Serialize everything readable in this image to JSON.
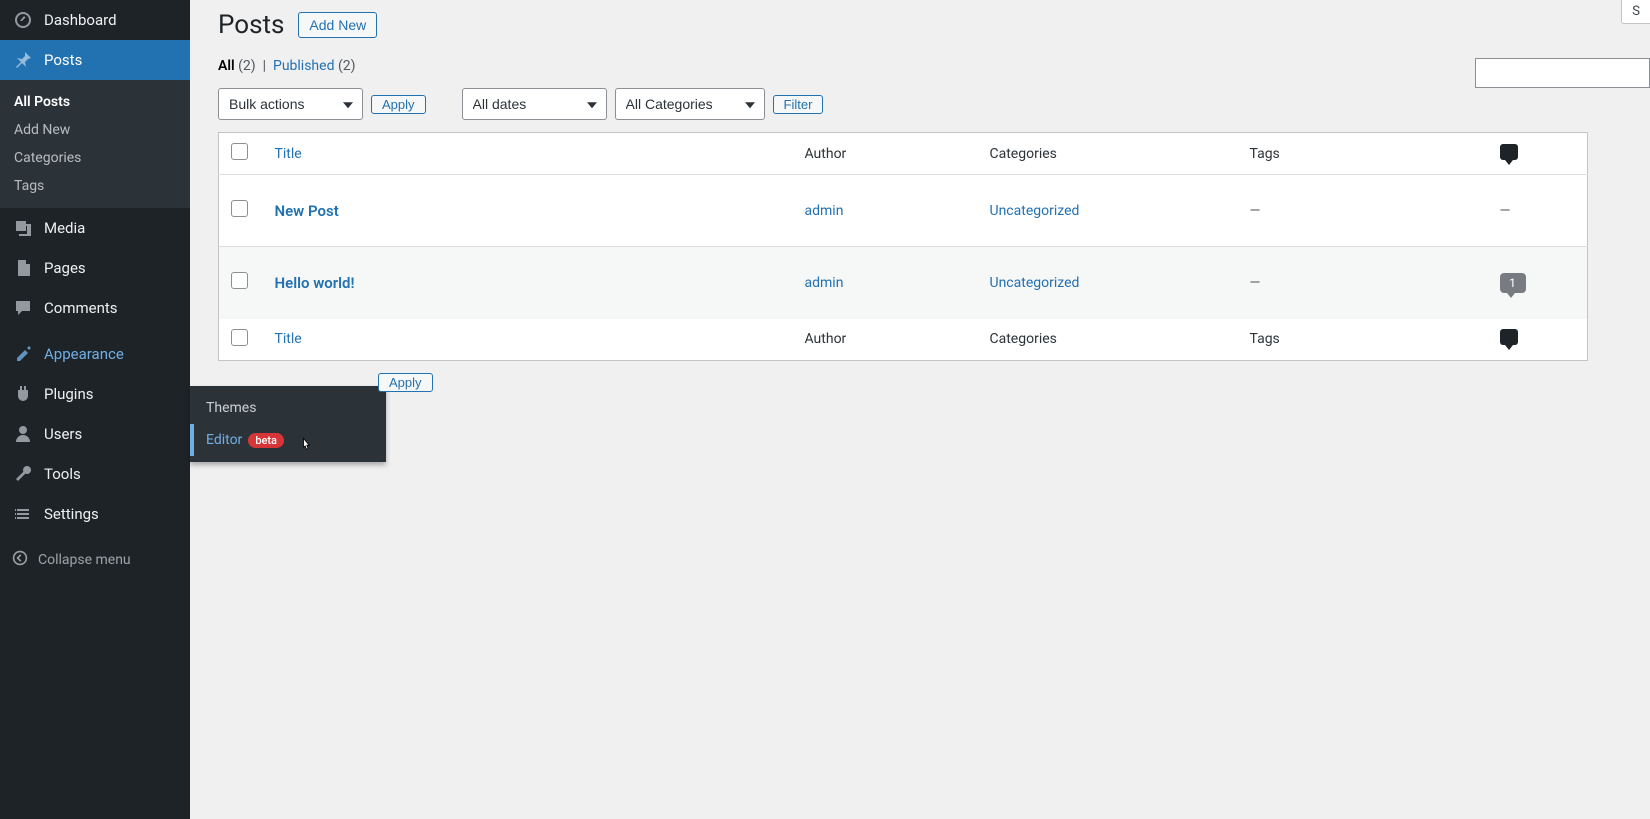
{
  "sidebar": {
    "dashboard": "Dashboard",
    "posts": "Posts",
    "media": "Media",
    "pages": "Pages",
    "comments": "Comments",
    "appearance": "Appearance",
    "plugins": "Plugins",
    "users": "Users",
    "tools": "Tools",
    "settings": "Settings",
    "collapse": "Collapse menu",
    "posts_sub": {
      "all_posts": "All Posts",
      "add_new": "Add New",
      "categories": "Categories",
      "tags": "Tags"
    }
  },
  "appearance_flyout": {
    "themes": "Themes",
    "editor": "Editor",
    "beta": "beta"
  },
  "heading": {
    "title": "Posts",
    "add_new": "Add New"
  },
  "screen_opts": "S",
  "views": {
    "all": "All",
    "all_count": "(2)",
    "sep": "|",
    "published": "Published",
    "published_count": "(2)"
  },
  "filters": {
    "bulk_actions": "Bulk actions",
    "apply": "Apply",
    "all_dates": "All dates",
    "all_categories": "All Categories",
    "filter": "Filter"
  },
  "table": {
    "cols": {
      "title": "Title",
      "author": "Author",
      "categories": "Categories",
      "tags": "Tags"
    },
    "rows": [
      {
        "title": "New Post",
        "author": "admin",
        "categories": "Uncategorized",
        "tags": "—",
        "comments": "—"
      },
      {
        "title": "Hello world!",
        "author": "admin",
        "categories": "Uncategorized",
        "tags": "—",
        "comments": "1"
      }
    ]
  }
}
